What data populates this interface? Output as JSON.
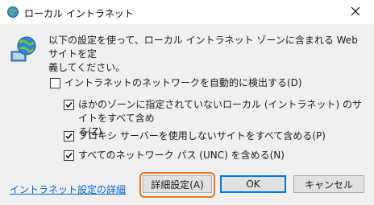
{
  "window": {
    "title": "ローカル イントラネット",
    "icon": "globe-network-icon",
    "close_icon": "close-icon"
  },
  "description": {
    "line1": "以下の設定を使って、ローカル イントラネット ゾーンに含まれる Web サイトを定",
    "line2": "義してください。"
  },
  "options": [
    {
      "label": "イントラネットのネットワークを自動的に検出する(D)",
      "checked": false
    },
    {
      "label_line1": "ほかのゾーンに指定されていないローカル (イントラネット) のサイトをすべて含め",
      "label_line2": "る(Z)",
      "checked": true
    },
    {
      "label": "プロキシ サーバーを使用しないサイトをすべて含める(P)",
      "checked": true
    },
    {
      "label": "すべてのネットワーク パス (UNC) を含める(N)",
      "checked": true
    }
  ],
  "link": {
    "label": "イントラネット設定の詳細"
  },
  "buttons": {
    "advanced": "詳細設定(A)",
    "ok": "OK",
    "cancel": "キャンセル"
  },
  "colors": {
    "link": "#0066cc",
    "highlight": "#e07b1a",
    "ok_border": "#0078d7"
  }
}
